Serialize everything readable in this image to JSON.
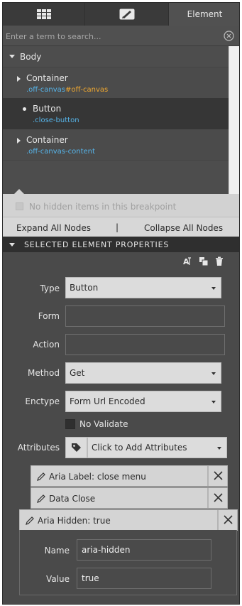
{
  "tabs": {
    "grid_icon": "grid-icon",
    "design_icon": "design-icon",
    "element_label": "Element"
  },
  "search": {
    "placeholder": "Enter a term to search...",
    "value": ""
  },
  "tree": {
    "root_label": "Body",
    "nodes": [
      {
        "label": "Container",
        "class": ".off-canvas",
        "id": "#off-canvas",
        "selected": false
      },
      {
        "label": "Button",
        "class": ".close-button",
        "selected": true
      },
      {
        "label": "Container",
        "class": ".off-canvas-content",
        "selected": false
      }
    ]
  },
  "hidden_items_text": "No hidden items in this breakpoint",
  "expand_all_label": "Expand All Nodes",
  "separator": "|",
  "collapse_all_label": "Collapse All Nodes",
  "section_title": "SELECTED ELEMENT PROPERTIES",
  "properties": {
    "type_label": "Type",
    "type_value": "Button",
    "form_label": "Form",
    "form_value": "",
    "action_label": "Action",
    "action_value": "",
    "method_label": "Method",
    "method_value": "Get",
    "enctype_label": "Enctype",
    "enctype_value": "Form Url Encoded",
    "no_validate_label": "No Validate",
    "no_validate_checked": false,
    "attributes_label": "Attributes",
    "attributes_select": "Click to Add Attributes"
  },
  "attributes": [
    {
      "label": "Aria Label: close menu"
    },
    {
      "label": "Data Close"
    },
    {
      "label": "Aria Hidden: true"
    }
  ],
  "expanded_attribute": {
    "name_label": "Name",
    "name_value": "aria-hidden",
    "value_label": "Value",
    "value_value": "true"
  },
  "colors": {
    "panel": "#4a4a4a",
    "selected_row": "#363636",
    "class_text": "#56b4e9",
    "id_text": "#f0a830"
  }
}
